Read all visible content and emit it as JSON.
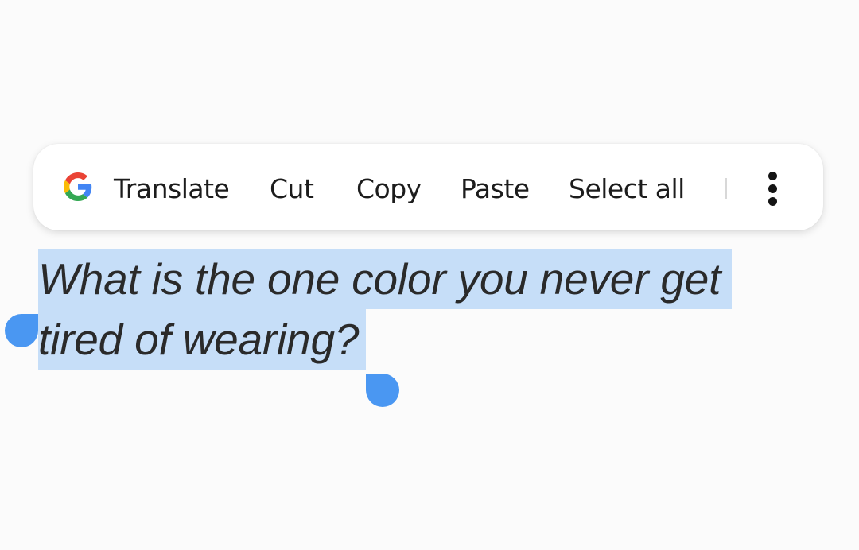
{
  "context_menu": {
    "items": [
      {
        "label": "Translate",
        "icon": "google-g-icon"
      },
      {
        "label": "Cut"
      },
      {
        "label": "Copy"
      },
      {
        "label": "Paste"
      },
      {
        "label": "Select all"
      }
    ],
    "more_icon": "more-vertical-icon"
  },
  "selected_text": {
    "lines": [
      "What is the one color you never get",
      "tired of wearing?"
    ]
  },
  "colors": {
    "background": "#fbfbfb",
    "selection_highlight": "#c6def8",
    "selection_handle": "#4a97f2",
    "text": "#2a2a2a",
    "google_blue": "#4285F4",
    "google_red": "#EA4335",
    "google_yellow": "#FBBC05",
    "google_green": "#34A853"
  }
}
